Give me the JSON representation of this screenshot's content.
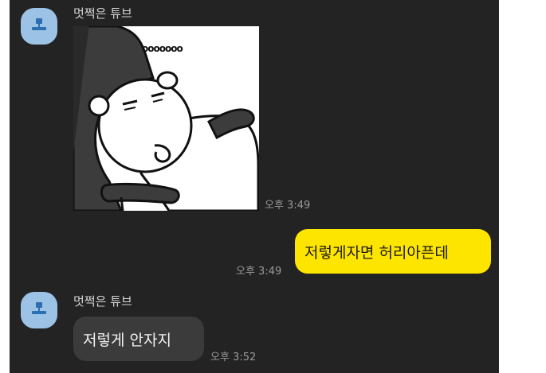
{
  "messages": [
    {
      "sender": "멋쩍은 튜브",
      "type": "sticker",
      "sticker_text": "ooooooo",
      "time": "오후 3:49",
      "avatar_icon": "profile-person-icon"
    },
    {
      "direction": "outgoing",
      "text": "저렇게자면 허리아픈데",
      "time": "오후 3:49"
    },
    {
      "sender": "멋쩍은 튜브",
      "type": "text",
      "text": "저렇게 안자지",
      "time": "오후 3:52",
      "avatar_icon": "profile-person-icon"
    }
  ],
  "colors": {
    "background": "#232323",
    "outgoing_bubble": "#fee500",
    "incoming_bubble": "#3b3b3b",
    "avatar": "#9cc3e6"
  }
}
